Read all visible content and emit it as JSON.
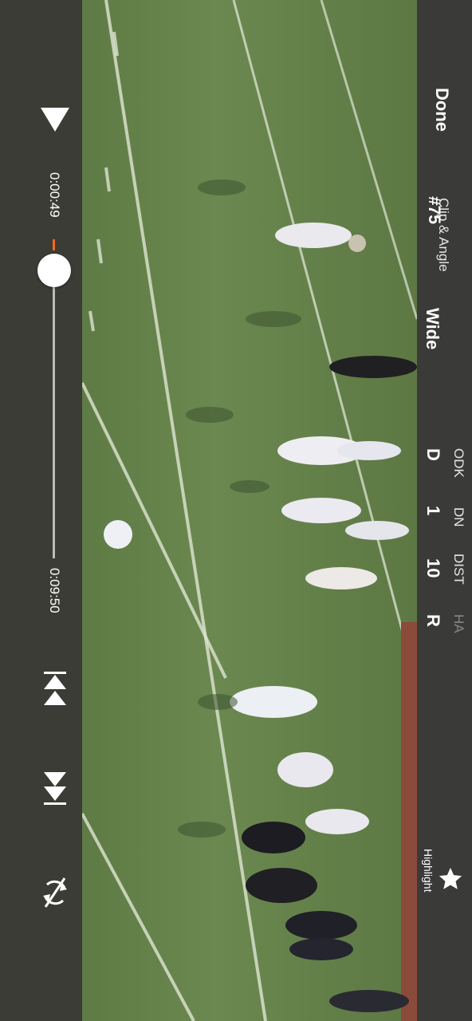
{
  "player": {
    "time_current": "0:00:49",
    "time_total": "0:09:50",
    "progress_fraction": 0.01
  },
  "header": {
    "done_label": "Done",
    "clip_angle_label": "Clip & Angle",
    "clip_number": "#75",
    "angle_value": "Wide"
  },
  "stats": [
    {
      "label": "ODK",
      "value": "D"
    },
    {
      "label": "DN",
      "value": "1"
    },
    {
      "label": "DIST",
      "value": "10"
    },
    {
      "label": "HA",
      "value": "R"
    }
  ],
  "highlight_label": "Highlight",
  "colors": {
    "accent": "#f26a1b",
    "field": "#6b8850",
    "bar": "#3b3c35"
  },
  "icons": [
    "play-icon",
    "skip-back-icon",
    "skip-forward-icon",
    "rotate-icon",
    "star-icon"
  ]
}
